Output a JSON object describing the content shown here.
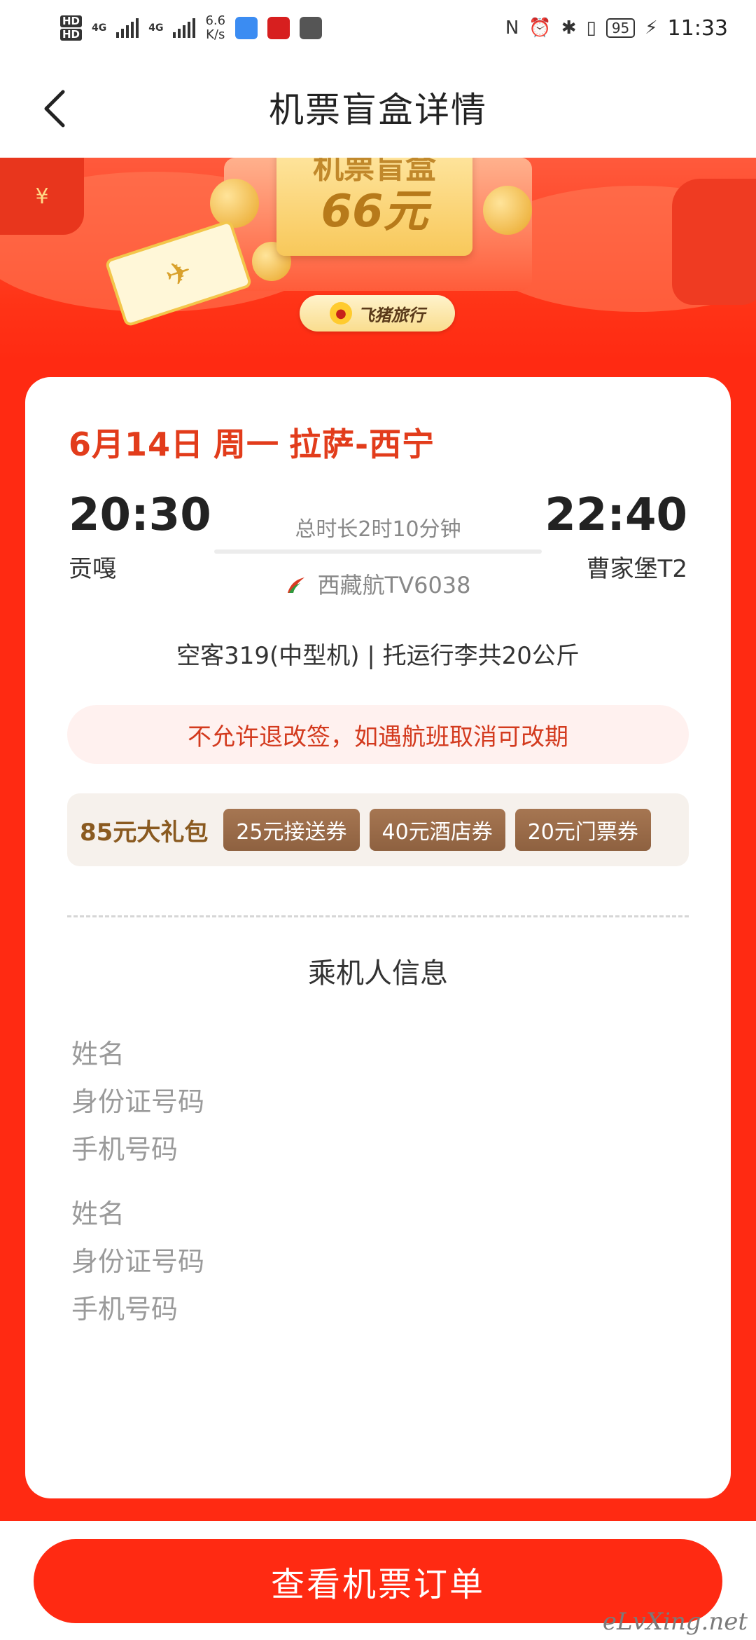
{
  "status_bar": {
    "network_type_1": "4G",
    "network_type_2": "4G",
    "speed": "6.6",
    "speed_unit": "K/s",
    "battery": "95",
    "time": "11:33"
  },
  "nav": {
    "title": "机票盲盒详情"
  },
  "banner": {
    "box_title": "机票盲盒",
    "box_price": "66元",
    "brand": "飞猪旅行",
    "redpack_symbol": "¥"
  },
  "flight": {
    "date": "6月14日",
    "weekday": "周一",
    "route": "拉萨-西宁",
    "departure_time": "20:30",
    "departure_airport": "贡嘎",
    "arrival_time": "22:40",
    "arrival_airport": "曹家堡T2",
    "duration": "总时长2时10分钟",
    "airline": "西藏航TV6038",
    "aircraft_info": "空客319(中型机) | 托运行李共20公斤",
    "notice": "不允许退改签，如遇航班取消可改期"
  },
  "gift": {
    "title": "85元大礼包",
    "coupons": [
      "25元接送券",
      "40元酒店券",
      "20元门票券"
    ]
  },
  "passenger": {
    "section_title": "乘机人信息",
    "passengers": [
      {
        "name_placeholder": "姓名",
        "id_placeholder": "身份证号码",
        "phone_placeholder": "手机号码"
      },
      {
        "name_placeholder": "姓名",
        "id_placeholder": "身份证号码",
        "phone_placeholder": "手机号码"
      }
    ]
  },
  "bottom": {
    "order_button": "查看机票订单"
  },
  "watermark": "eLvXing.net",
  "colors": {
    "brand_red": "#ff2a12",
    "route_red": "#e23c1b",
    "coupon_brown": "#8e6140",
    "gift_text": "#8a5a20"
  }
}
